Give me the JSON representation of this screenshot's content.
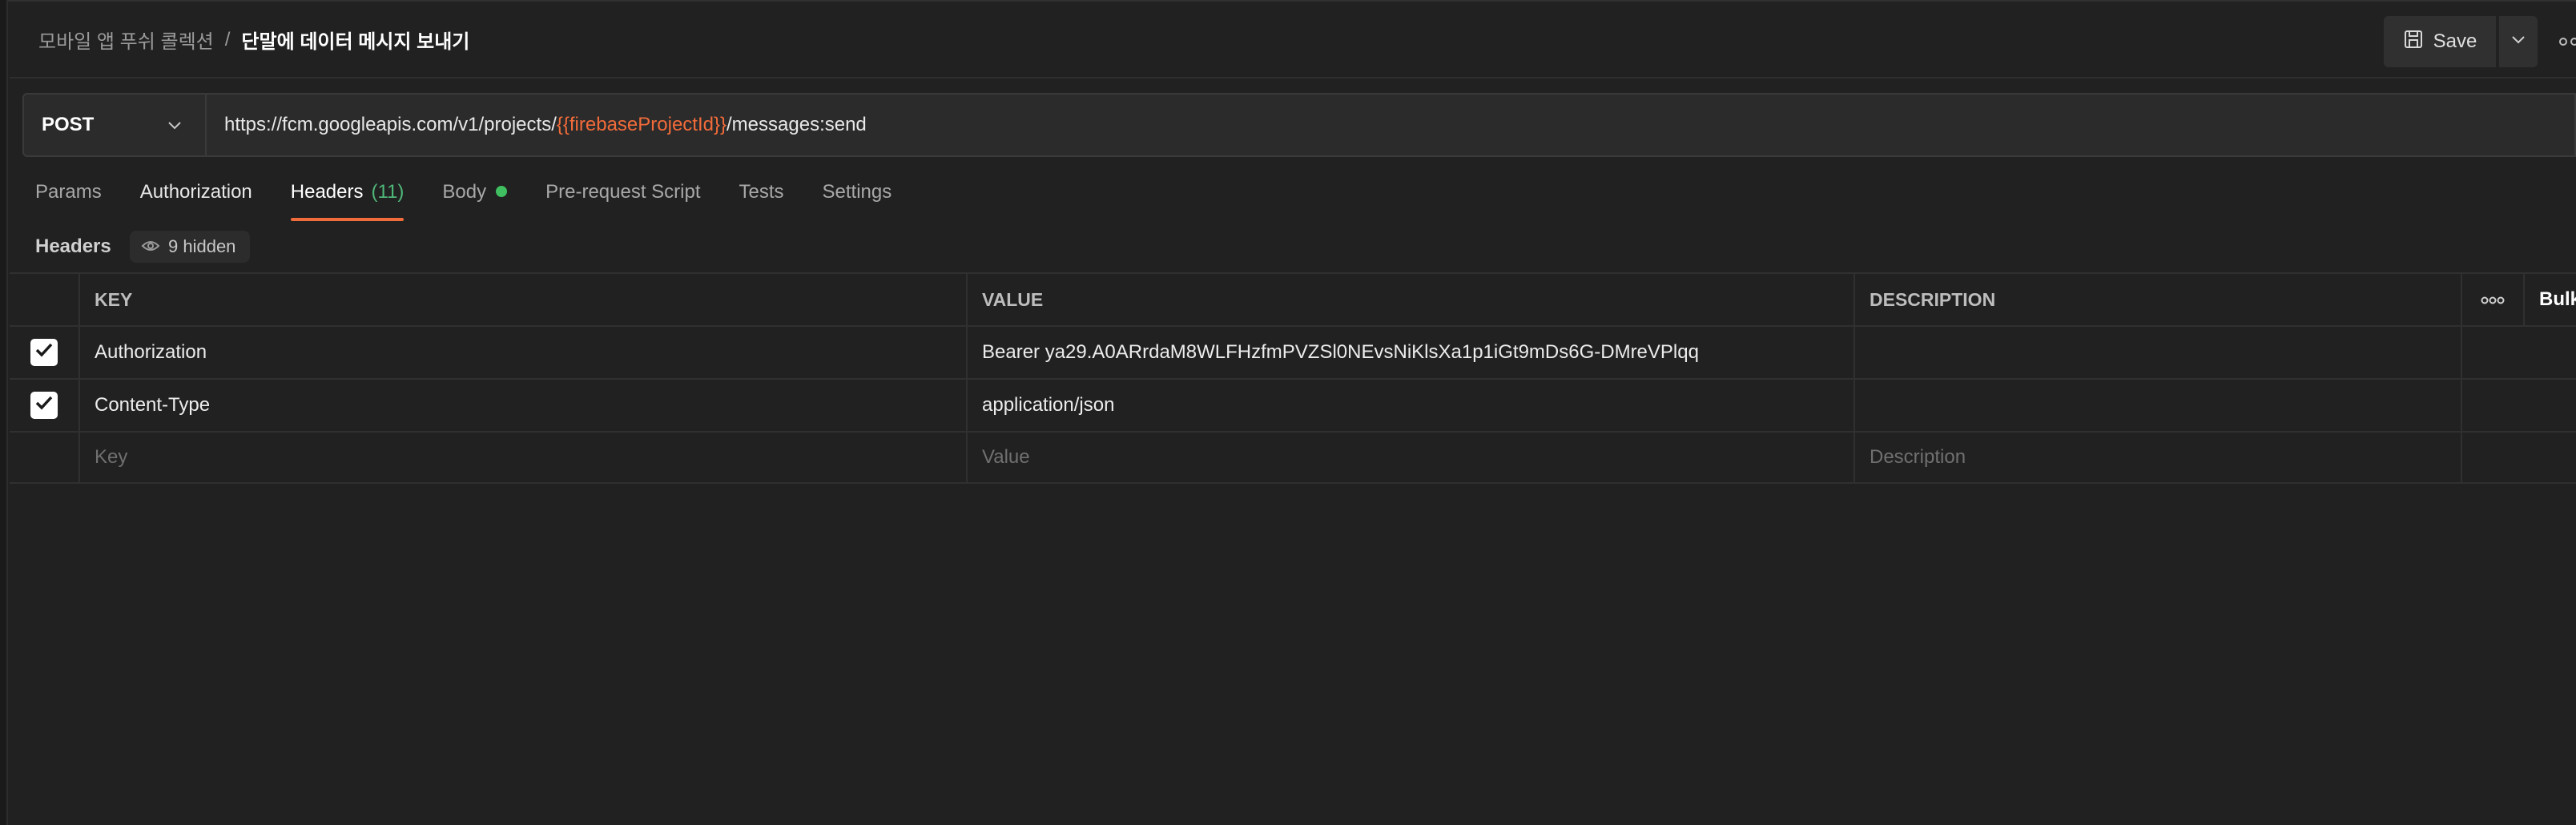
{
  "breadcrumb": {
    "parent": "모바일 앱 푸쉬 콜렉션",
    "separator": "/",
    "current": "단말에 데이터 메시지 보내기"
  },
  "toolbar": {
    "save_label": "Save"
  },
  "request": {
    "method": "POST",
    "url_prefix": "https://fcm.googleapis.com/v1/projects/",
    "url_variable": "{{firebaseProjectId}}",
    "url_suffix": "/messages:send"
  },
  "tabs": [
    {
      "label": "Params"
    },
    {
      "label": "Authorization"
    },
    {
      "label": "Headers",
      "count": "(11)"
    },
    {
      "label": "Body"
    },
    {
      "label": "Pre-request Script"
    },
    {
      "label": "Tests"
    },
    {
      "label": "Settings"
    }
  ],
  "headers_section": {
    "title": "Headers",
    "hidden_label": "9 hidden"
  },
  "table": {
    "columns": {
      "key": "KEY",
      "value": "VALUE",
      "description": "DESCRIPTION",
      "bulk": "Bulk"
    },
    "rows": [
      {
        "checked": true,
        "key": "Authorization",
        "value": "Bearer ya29.A0ARrdaM8WLFHzfmPVZSl0NEvsNiKlsXa1p1iGt9mDs6G-DMreVPlqq",
        "description": ""
      },
      {
        "checked": true,
        "key": "Content-Type",
        "value": "application/json",
        "description": ""
      }
    ],
    "placeholders": {
      "key": "Key",
      "value": "Value",
      "description": "Description"
    }
  },
  "colors": {
    "accent": "#f26b3a",
    "count_green": "#4fb77a",
    "dot_green": "#3fbf5f",
    "background": "#212121"
  },
  "icons": [
    "save-icon",
    "chevron-down-icon",
    "more-horizontal-icon",
    "eye-icon",
    "checkbox-checked-icon"
  ]
}
